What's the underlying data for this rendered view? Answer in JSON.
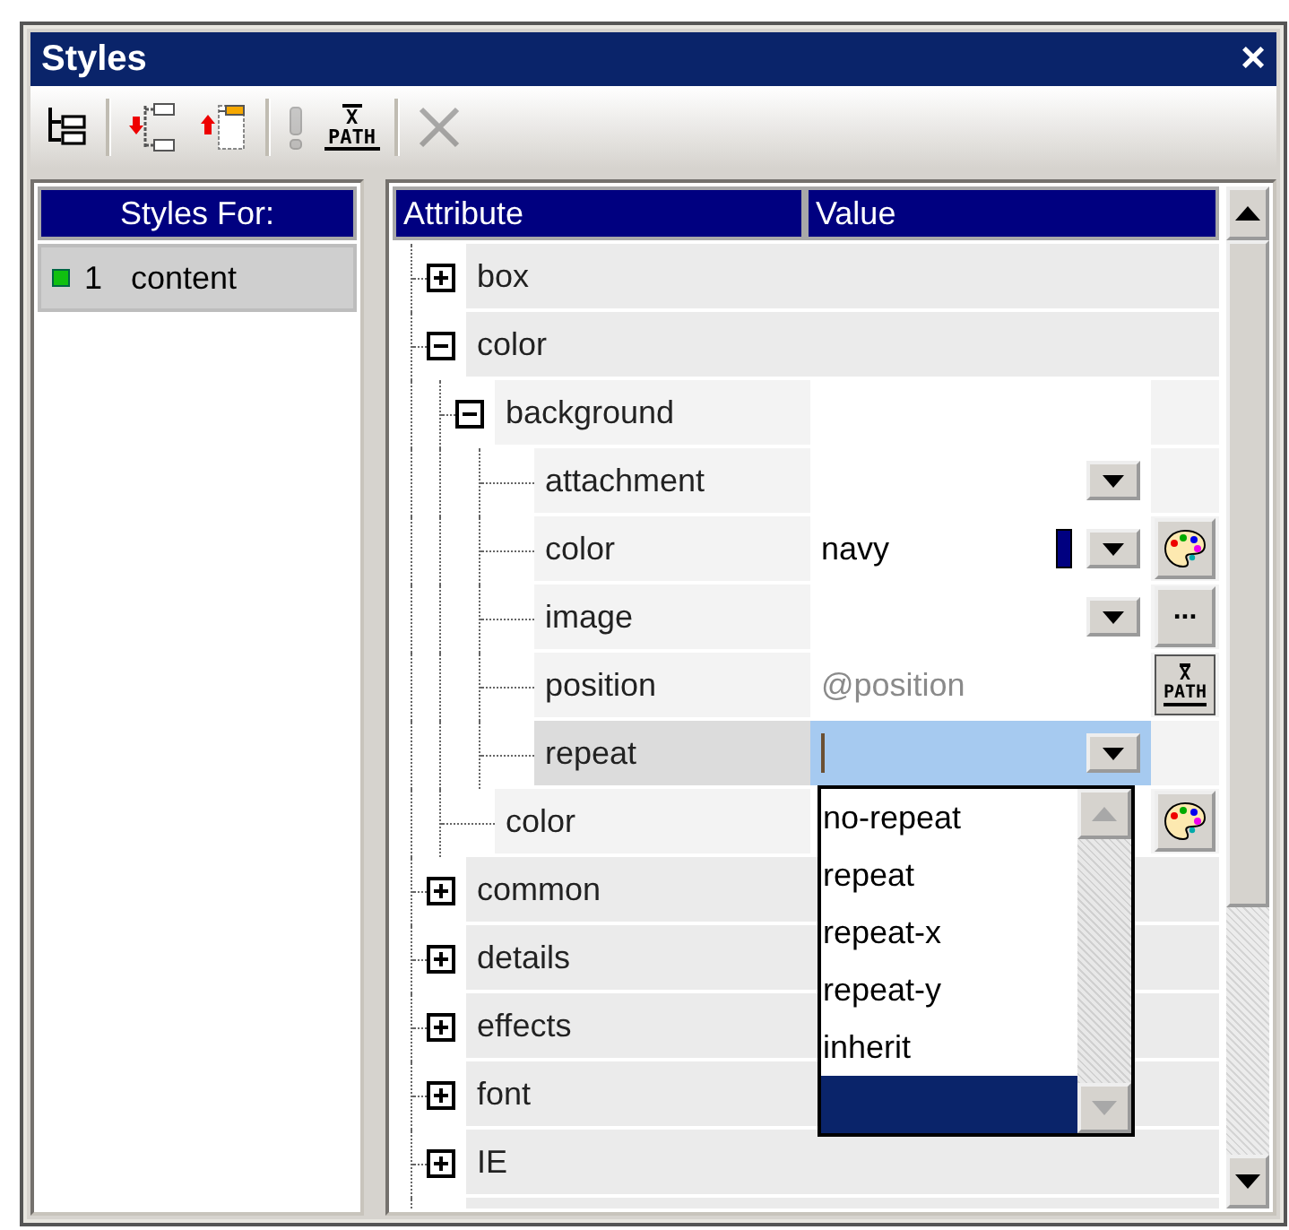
{
  "window": {
    "title": "Styles",
    "close": "×"
  },
  "toolbar": [
    {
      "kind": "tree",
      "disabled": false
    },
    {
      "kind": "separator"
    },
    {
      "kind": "insert",
      "disabled": false
    },
    {
      "kind": "append",
      "disabled": false
    },
    {
      "kind": "separator"
    },
    {
      "kind": "important",
      "disabled": true
    },
    {
      "kind": "xpath",
      "lines": [
        "X",
        "PATH"
      ],
      "disabled": false
    },
    {
      "kind": "separator"
    },
    {
      "kind": "delete",
      "disabled": true
    }
  ],
  "styles_for": {
    "header": "Styles For:",
    "items": [
      {
        "number": "1",
        "label": "content",
        "selected": true
      }
    ]
  },
  "attributes": {
    "columns": [
      "Attribute",
      "Value"
    ],
    "rows": [
      {
        "label": "box",
        "expanded": false,
        "selected": false
      },
      {
        "label": "color",
        "expanded": true,
        "selected": false,
        "children": [
          {
            "label": "background",
            "expanded": true,
            "selected": false,
            "children": [
              {
                "label": "attachment",
                "selected": false,
                "dropdown": true
              },
              {
                "label": "color",
                "selected": false,
                "value": "navy",
                "color": "#000080",
                "dropdown": true,
                "button": {
                  "kind": "palette"
                }
              },
              {
                "label": "image",
                "selected": false,
                "dropdown": true,
                "button": {
                  "kind": "more",
                  "text": "..."
                }
              },
              {
                "label": "position",
                "selected": false,
                "placeholder": "@position",
                "button": {
                  "kind": "xpath",
                  "lines": [
                    "X",
                    "PATH"
                  ]
                }
              },
              {
                "label": "repeat",
                "selected": true,
                "dropdown": true,
                "open": true,
                "blank_selected": true,
                "options": [
                  {
                    "label": "no-repeat",
                    "selected": false
                  },
                  {
                    "label": "repeat",
                    "selected": false
                  },
                  {
                    "label": "repeat-x",
                    "selected": false
                  },
                  {
                    "label": "repeat-y",
                    "selected": false
                  },
                  {
                    "label": "inherit",
                    "selected": false
                  }
                ]
              }
            ]
          },
          {
            "label": "color",
            "selected": false,
            "button": {
              "kind": "palette"
            }
          }
        ]
      },
      {
        "label": "common",
        "expanded": false,
        "selected": false
      },
      {
        "label": "details",
        "expanded": false,
        "selected": false
      },
      {
        "label": "effects",
        "expanded": false,
        "selected": false
      },
      {
        "label": "font",
        "expanded": false,
        "selected": false
      },
      {
        "label": "IE",
        "expanded": false,
        "selected": false
      }
    ]
  }
}
